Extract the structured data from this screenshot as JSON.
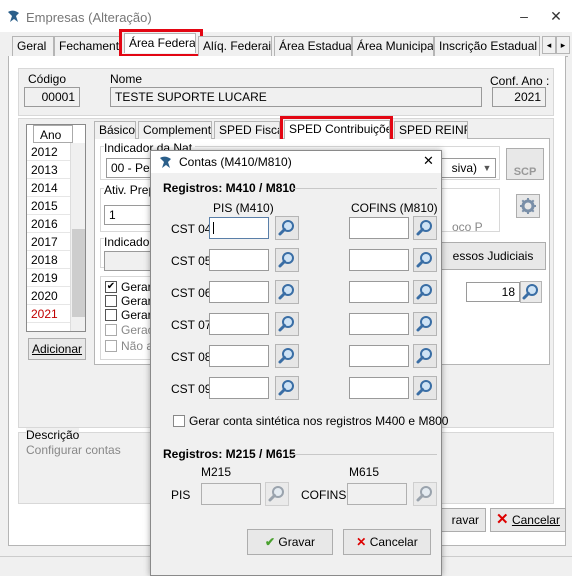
{
  "window": {
    "title": "Empresas (Alteração)"
  },
  "tabs": [
    "Geral",
    "Fechamento",
    "Área Federal",
    "Alíq. Federais",
    "Área Estadual",
    "Área Municipal",
    "Inscrição Estadual S"
  ],
  "header": {
    "codigo_label": "Código",
    "codigo_value": "00001",
    "nome_label": "Nome",
    "nome_value": "TESTE SUPORTE LUCARE",
    "conf_ano_label": "Conf. Ano :",
    "conf_ano_value": "2021"
  },
  "years": {
    "header": "Ano",
    "items": [
      "2012",
      "2013",
      "2014",
      "2015",
      "2016",
      "2017",
      "2018",
      "2019",
      "2020",
      "2021"
    ],
    "selected": "2021",
    "add_button": "Adicionar"
  },
  "subtabs": [
    "Básico",
    "Complemento",
    "SPED Fiscal",
    "SPED Contribuições",
    "SPED REINF"
  ],
  "background_panel": {
    "indicador_label": "Indicador da Nat.",
    "indicador_value": "00 - Pes",
    "indicador_tail": "siva)",
    "scp_label": "SCP",
    "ativ_label": "Ativ. Prep",
    "ativ_value": "1",
    "ativ_tail": "oco P",
    "indicador2_label": "Indicador",
    "processos_button": "essos Judiciais",
    "check_items": [
      "Gerar",
      "Gerar",
      "Gerar",
      "Geraç",
      "Não a"
    ],
    "number_value": "18"
  },
  "descricao": {
    "label": "Descrição",
    "value": "Configurar contas"
  },
  "footer": {
    "gravar_label": "ravar",
    "cancelar_label": "Cancelar"
  },
  "dialog": {
    "title": "Contas (M410/M810)",
    "section1_title": "Registros: M410 / M810",
    "pis_header": "PIS (M410)",
    "cofins_header": "COFINS (M810)",
    "cst_rows": [
      "CST 04",
      "CST 05",
      "CST 06",
      "CST 07",
      "CST 08",
      "CST 09"
    ],
    "checkbox_label": "Gerar conta sintética nos registros M400 e M800",
    "section2_title": "Registros: M215 / M615",
    "m215_label": "M215",
    "m615_label": "M615",
    "pis_label": "PIS",
    "cofins_label": "COFINS",
    "save_button": "Gravar",
    "cancel_button": "Cancelar"
  },
  "colors": {
    "highlight_red": "#e30613",
    "selected_year": "#c00000"
  }
}
